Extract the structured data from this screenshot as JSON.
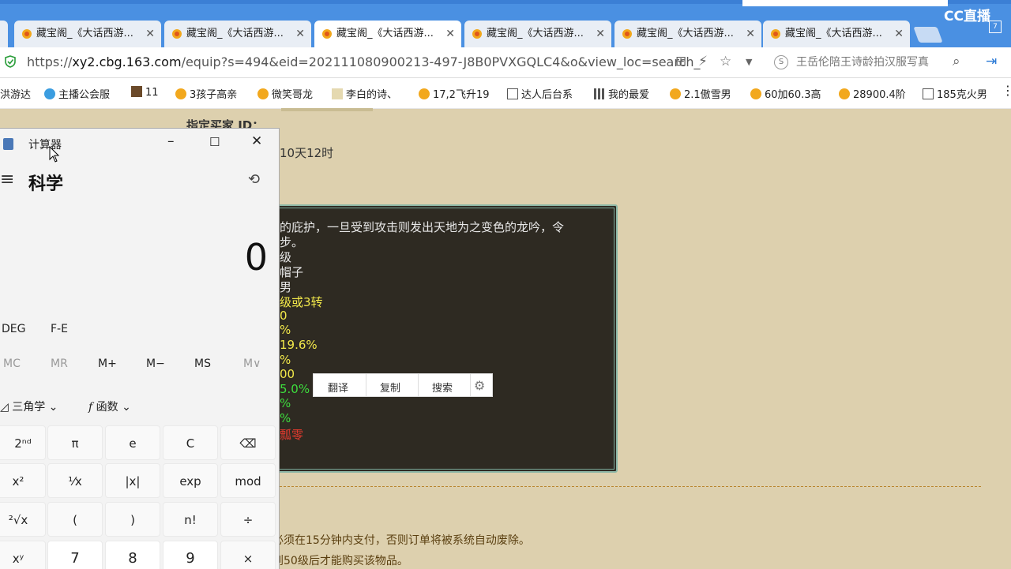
{
  "browser": {
    "tabs": [
      {
        "label": "藏宝阁_《大话西游..."
      },
      {
        "label": "藏宝阁_《大话西游..."
      },
      {
        "label": "藏宝阁_《大话西游..."
      },
      {
        "label": "藏宝阁_《大话西游..."
      },
      {
        "label": "藏宝阁_《大话西游..."
      },
      {
        "label": "藏宝阁_《大话西游..."
      }
    ],
    "first_tab_partial": "",
    "url_prefix": "https://",
    "url_host": "xy2.cbg.163.com",
    "url_rest": "/equip?s=494&eid=202111080900213-497-J8B0PVXGQLC4&o&view_loc=search_",
    "search_suggestion": "王岳伦陪王诗龄拍汉服写真",
    "cc_logo": "CC直播",
    "cc_badge": "7"
  },
  "bookmarks": [
    "洪游达",
    "主播公会服",
    "11",
    "3孩子高亲",
    "微笑哥龙",
    "李白的诗、",
    "17,2飞升19",
    "达人后台系",
    "我的最爱",
    "2.1傲雪男",
    "60加60.3高",
    "28900.4阶",
    "185克火男"
  ],
  "page": {
    "buyer_label": "指定买家 ID：",
    "time_left": "10天12时",
    "desc_line1": "的庇护，一旦受到攻击则发出天地为之变色的龙吟，令",
    "desc_line2": "步。",
    "lines": [
      {
        "text": "级",
        "color": "#e8e8e8"
      },
      {
        "text": "帽子",
        "color": "#e8e8e8"
      },
      {
        "text": "男",
        "color": "#e8e8e8"
      },
      {
        "text": "级或3转",
        "color": "#f2e84a"
      },
      {
        "text": "0",
        "color": "#f2e84a"
      },
      {
        "text": "%",
        "color": "#f2e84a"
      },
      {
        "text": "19.6%",
        "color": "#f2e84a"
      },
      {
        "text": "%",
        "color": "#f2e84a"
      },
      {
        "text": "00",
        "color": "#f2e84a"
      },
      {
        "text": "5.0%",
        "color": "#3ddc3d"
      },
      {
        "text": "%",
        "color": "#3ddc3d"
      },
      {
        "text": "%",
        "color": "#3ddc3d"
      },
      {
        "text": "瓢零",
        "color": "#e03a2e"
      }
    ],
    "context_menu": {
      "translate": "翻译",
      "copy": "复制",
      "search": "搜索"
    },
    "notice1": "必须在15分钟内支付，否则订单将被系统自动废除。",
    "notice2": "到50级后才能购买该物品。"
  },
  "calculator": {
    "title": "计算器",
    "mode": "科学",
    "display": "0",
    "angle": "DEG",
    "fe": "F-E",
    "memory": [
      "MC",
      "MR",
      "M+",
      "M−",
      "MS",
      "M∨"
    ],
    "trig": "三角学",
    "func": "函数",
    "keys": [
      [
        "2ⁿᵈ",
        "π",
        "e",
        "C",
        "⌫"
      ],
      [
        "x²",
        "¹⁄x",
        "|x|",
        "exp",
        "mod"
      ],
      [
        "²√x",
        "(",
        ")",
        "n!",
        "÷"
      ],
      [
        "xʸ",
        "7",
        "8",
        "9",
        "×"
      ]
    ]
  }
}
